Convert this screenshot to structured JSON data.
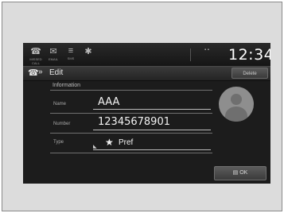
{
  "status_bar": {
    "icons": [
      {
        "name": "missed-call-icon",
        "glyph": "☎",
        "label": "MISSED CALL"
      },
      {
        "name": "email-icon",
        "glyph": "✉",
        "label": "EMAIL"
      },
      {
        "name": "sms-icon",
        "glyph": "≡",
        "label": "SMS"
      },
      {
        "name": "bluetooth-icon",
        "glyph": "✱",
        "label": ""
      }
    ],
    "indicator": "▪ ▪",
    "clock": "12:34"
  },
  "title_bar": {
    "phone_icon": "☎",
    "chevron": "»",
    "title": "Edit",
    "delete_label": "Delete"
  },
  "form": {
    "section_label": "Information",
    "name_label": "Name",
    "name_value": "AAA",
    "number_label": "Number",
    "number_value": "12345678901",
    "type_label": "Type",
    "type_marker": "◣",
    "type_star": "★",
    "type_value": "Pref"
  },
  "confirm_label": "▤ OK"
}
